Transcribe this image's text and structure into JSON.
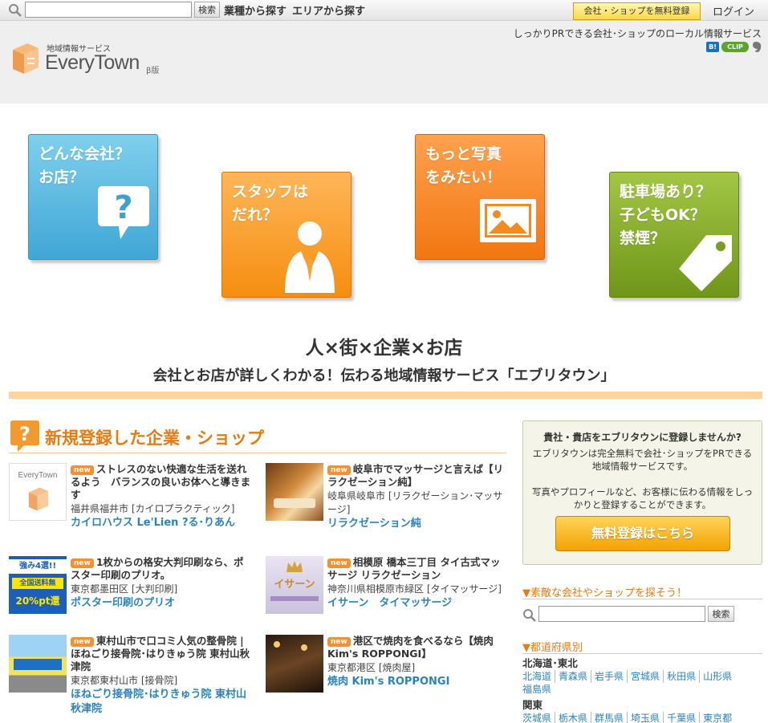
{
  "topbar": {
    "search_placeholder": "",
    "search_button": "検索",
    "nav_industry": "業種から探す",
    "nav_area": "エリアから探す",
    "register_button": "会社・ショップを無料登録",
    "login": "ログイン"
  },
  "header": {
    "logo_sub": "地域情報サービス",
    "logo_main": "EveryTown",
    "logo_beta": "β版",
    "tagline": "しっかりPRできる会社･ショップのローカル情報サービス",
    "hatena_label": "B!",
    "clip_label": "CLIP"
  },
  "tiles": [
    {
      "text": "どんな会社？\nお店？",
      "icon": "question-bubble-icon"
    },
    {
      "text": "スタッフは\nだれ？",
      "icon": "staff-person-icon"
    },
    {
      "text": "もっと写真\nをみたい！",
      "icon": "photo-icon"
    },
    {
      "text": "駐車場あり？\n子どもOK？\n禁煙？",
      "icon": "tag-icon"
    }
  ],
  "headline": "人×街×企業×お店",
  "subheadline": "会社とお店が詳しくわかる！伝わる地域情報サービス「エブリタウン」",
  "new_section": {
    "title": "新規登録した企業・ショップ",
    "badge": "new",
    "thumb_logo": "EveryTown",
    "thumb_print_line1": "強み4選!!",
    "thumb_print_line2": "全国送料無",
    "thumb_print_line3": "20%pt還",
    "thumb_isaan": "イサーン",
    "listings": [
      {
        "title": "ストレスのない快適な生活を送れるよう　バランスの良いお体へと導きます",
        "location": "福井県福井市 [カイロプラクティック]",
        "name": "カイロハウス Le'Lien ?る･りあん"
      },
      {
        "title": "岐阜市でマッサージと言えば【リラクゼーション純】",
        "location": "岐阜県岐阜市 [リラクゼーション･マッサージ]",
        "name": "リラクゼーション純"
      },
      {
        "title": "1枚からの格安大判印刷なら、ポスター印刷のプリオ。",
        "location": "東京都墨田区 [大判印刷]",
        "name": "ポスター印刷のプリオ"
      },
      {
        "title": "相模原 橋本三丁目 タイ古式マッサージ リラクゼーション",
        "location": "神奈川県相模原市緑区 [タイマッサージ]",
        "name": "イサーン　タイマッサージ"
      },
      {
        "title": "東村山市で口コミ人気の整骨院 | ほねごり接骨院･はりきゅう院 東村山秋津院",
        "location": "東京都東村山市 [接骨院]",
        "name": "ほねごり接骨院･はりきゅう院 東村山秋津院"
      },
      {
        "title": "港区で焼肉を食べるなら【焼肉Kim's ROPPONGI】",
        "location": "東京都港区 [焼肉屋]",
        "name": "焼肉 Kim's ROPPONGI"
      }
    ]
  },
  "sidebar": {
    "promo_title": "貴社・貴店をエブリタウンに登録しませんか?",
    "promo_text": "エブリタウンは完全無料で会社･ショップをPRできる地域情報サービスです。\n\n写真やプロフィールなど、お客様に伝わる情報をしっかりと登録することができます。",
    "promo_button": "無料登録はこちら",
    "search_heading": "▼素敵な会社やショップを探そう！",
    "search_button": "検索",
    "pref_heading": "▼都道府県別",
    "regions": [
      {
        "name": "北海道･東北",
        "prefs": [
          "北海道",
          "青森県",
          "岩手県",
          "宮城県",
          "秋田県",
          "山形県",
          "福島県"
        ]
      },
      {
        "name": "関東",
        "prefs": [
          "茨城県",
          "栃木県",
          "群馬県",
          "埼玉県",
          "千葉県",
          "東京都"
        ]
      }
    ]
  }
}
